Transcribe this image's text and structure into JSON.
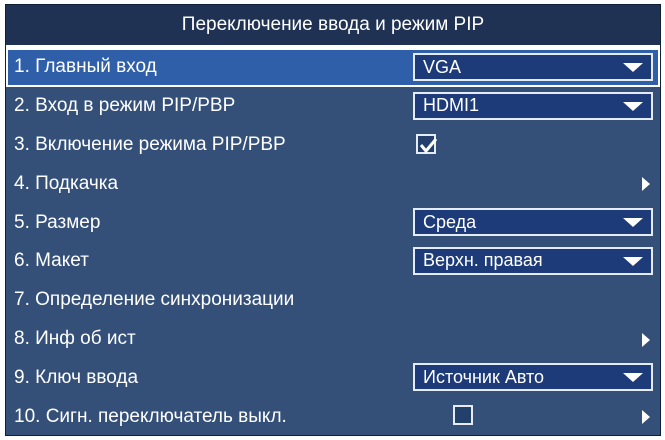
{
  "title": "Переключение ввода и режим PIP",
  "items": [
    {
      "label": "1.  Главный вход",
      "control": "select",
      "value": "VGA"
    },
    {
      "label": "2.  Вход в режим PIP/PBP",
      "control": "select",
      "value": "HDMI1"
    },
    {
      "label": "3.  Включение режима PIP/PBP",
      "control": "checkbox",
      "checked": true
    },
    {
      "label": "4.  Подкачка",
      "control": "submenu"
    },
    {
      "label": "5.  Размер",
      "control": "select",
      "value": "Среда"
    },
    {
      "label": "6.  Макет",
      "control": "select",
      "value": "Верхн. правая"
    },
    {
      "label": "7.  Определение синхронизации",
      "control": "none"
    },
    {
      "label": "8.  Инф об ист",
      "control": "submenu"
    },
    {
      "label": "9.  Ключ ввода",
      "control": "select",
      "value": "Источник Авто"
    },
    {
      "label": "10. Сигн. переключатель выкл.",
      "control": "checkbox-submenu",
      "checked": false
    }
  ],
  "colors": {
    "panel": "#345079",
    "title_bar": "#1f3253",
    "selected_row": "#2f5fa8",
    "select_box": "#1c3b78"
  }
}
